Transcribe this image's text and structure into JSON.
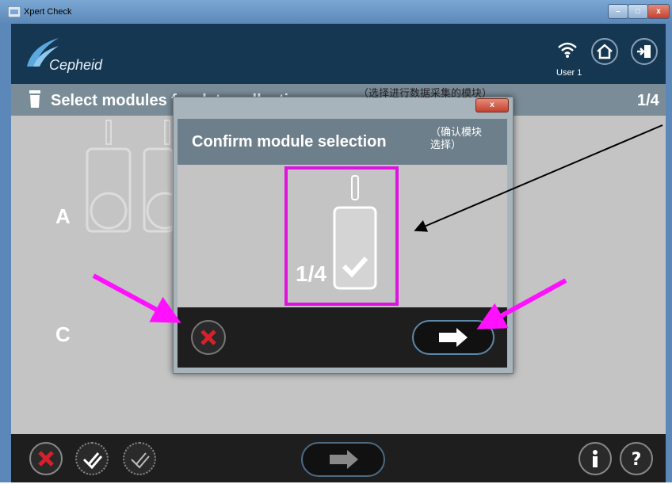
{
  "window": {
    "title": "Xpert Check",
    "minimize_label": "–",
    "maximize_label": "□",
    "close_label": "x"
  },
  "header": {
    "logo_text": "Cepheid",
    "user_label": "User 1"
  },
  "page": {
    "title": "Select modules for data collection",
    "counter": "1/4",
    "annotation": "（选择进行数据采集的模块）"
  },
  "rows": {
    "a": "A",
    "c": "C"
  },
  "dialog": {
    "close_label": "x",
    "title": "Confirm module selection",
    "annotation": "（确认模块选择）",
    "selected_count": "1/4"
  },
  "colors": {
    "highlight": "#e012e0",
    "arrow_magenta": "#ff10ff",
    "header_bg": "#163752",
    "cancel_red": "#d8202a"
  }
}
